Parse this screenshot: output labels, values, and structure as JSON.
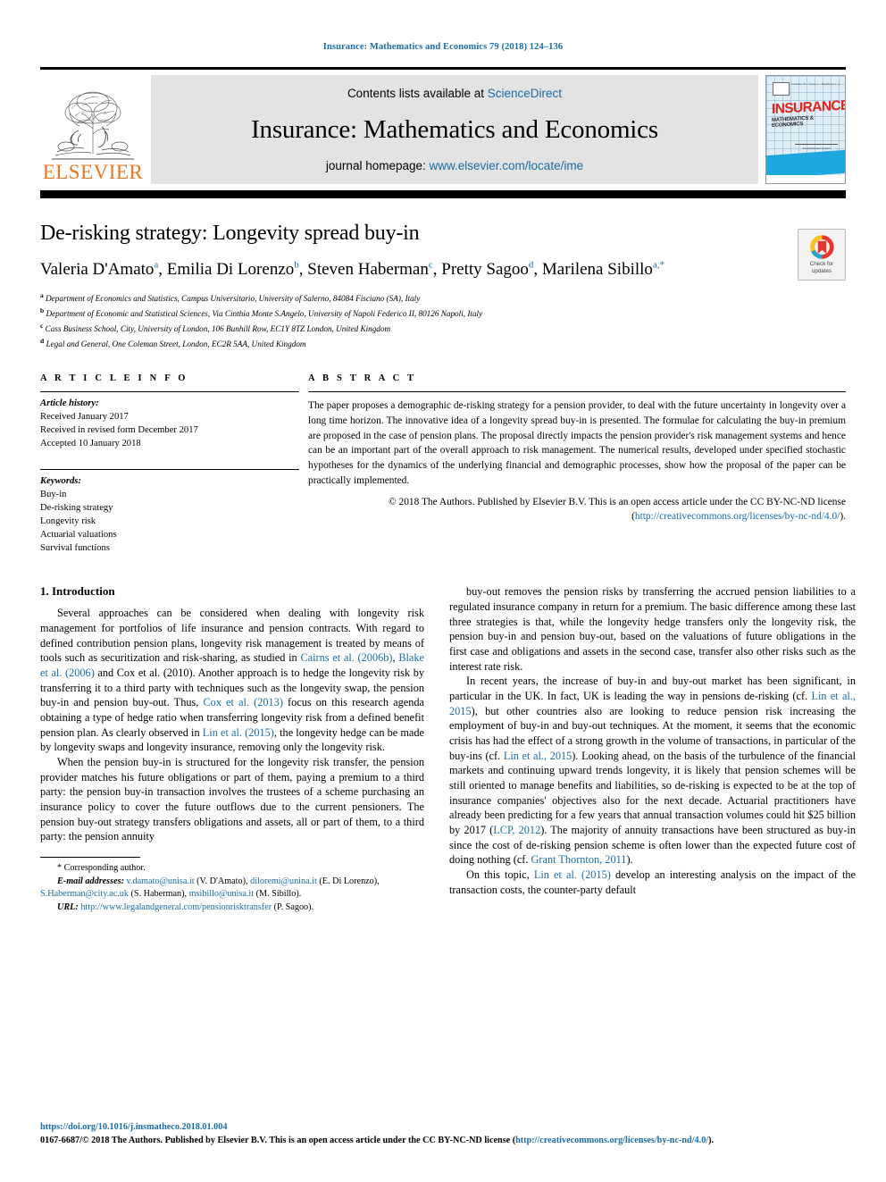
{
  "running_head": "Insurance: Mathematics and Economics 79 (2018) 124–136",
  "masthead": {
    "contents_prefix": "Contents lists available at ",
    "sciencedirect": "ScienceDirect",
    "journal_name": "Insurance: Mathematics and Economics",
    "homepage_prefix": "journal homepage: ",
    "homepage_url": "www.elsevier.com/locate/ime",
    "publisher_wordmark": "ELSEVIER",
    "publisher_color": "#E87722",
    "link_color": "#1b6ca8",
    "cover": {
      "title": "INSURANCE",
      "subtitle": "MATHEMATICS & ECONOMICS",
      "top_line": "Volume 79 / Issue 1 / Numbers 1–2              Nov 2018",
      "corner_note": "An International Journal",
      "band_color": "#1fa8e0",
      "title_color": "#e2231a"
    }
  },
  "article": {
    "title": "De-risking strategy: Longevity spread buy-in",
    "authors": [
      {
        "name": "Valeria D'Amato",
        "marks": "a",
        "sep": ", "
      },
      {
        "name": "Emilia Di Lorenzo",
        "marks": "b",
        "sep": ", "
      },
      {
        "name": "Steven Haberman",
        "marks": "c",
        "sep": ", "
      },
      {
        "name": "Pretty Sagoo",
        "marks": "d",
        "sep": ", "
      },
      {
        "name": "Marilena Sibillo",
        "marks": "a,*",
        "sep": ""
      }
    ],
    "affiliations": [
      {
        "mark": "a",
        "text": "Department of Economics and Statistics, Campus Universitario, University of Salerno, 84084 Fisciano (SA), Italy"
      },
      {
        "mark": "b",
        "text": "Department of Economic and Statistical Sciences, Via Cinthia Monte S.Angelo, University of Napoli Federico II, 80126 Napoli, Italy"
      },
      {
        "mark": "c",
        "text": "Cass Business School, City, University of London, 106 Bunhill Row, EC1Y 8TZ London, United Kingdom"
      },
      {
        "mark": "d",
        "text": "Legal and General, One Coleman Street, London, EC2R 5AA, United Kingdom"
      }
    ],
    "crossmark_label": "Check for\nupdates"
  },
  "article_info": {
    "heading": "A R T I C L E   I N F O",
    "history_label": "Article history:",
    "history": [
      "Received January 2017",
      "Received in revised form December 2017",
      "Accepted 10 January 2018"
    ],
    "keywords_label": "Keywords:",
    "keywords": [
      "Buy-in",
      "De-risking strategy",
      "Longevity risk",
      "Actuarial valuations",
      "Survival functions"
    ]
  },
  "abstract": {
    "heading": "A B S T R A C T",
    "text": "The paper proposes a demographic de-risking strategy for a pension provider, to deal with the future uncertainty in longevity over a long time horizon. The innovative idea of a longevity spread buy-in is presented. The formulae for calculating the buy-in premium are proposed in the case of pension plans. The proposal directly impacts the pension provider's risk management systems and hence can be an important part of the overall approach to risk management. The numerical results, developed under specified stochastic hypotheses for the dynamics of the underlying financial and demographic processes, show how the proposal of the paper can be practically implemented.",
    "copyright_text": "© 2018 The Authors. Published by Elsevier B.V. This is an open access article under the CC BY-NC-ND license (",
    "license_url": "http://creativecommons.org/licenses/by-nc-nd/4.0/",
    "copyright_tail": ")."
  },
  "body": {
    "section_title": "1. Introduction",
    "left_paragraphs": [
      "Several approaches can be considered when dealing with longevity risk management for portfolios of life insurance and pension contracts. With regard to defined contribution pension plans, longevity risk management is treated by means of tools such as securitization and risk-sharing, as studied in <ref>Cairns et al. (2006b)</ref>, <ref>Blake et al. (2006)</ref> and Cox et al. (2010). Another approach is to hedge the longevity risk by transferring it to a third party with techniques such as the longevity swap, the pension buy-in and pension buy-out. Thus, <ref>Cox et al. (2013)</ref> focus on this research agenda obtaining a type of hedge ratio when transferring longevity risk from a defined benefit pension plan. As clearly observed in <ref>Lin et al. (2015)</ref>, the longevity hedge can be made by longevity swaps and longevity insurance, removing only the longevity risk.",
      "When the pension buy-in is structured for the longevity risk transfer, the pension provider matches his future obligations or part of them, paying a premium to a third party: the pension buy-in transaction involves the trustees of a scheme purchasing an insurance policy to cover the future outflows due to the current pensioners. The pension buy-out strategy transfers obligations and assets, all or part of them, to a third party: the pension annuity"
    ],
    "right_paragraphs": [
      "buy-out removes the pension risks by transferring the accrued pension liabilities to a regulated insurance company in return for a premium. The basic difference among these last three strategies is that, while the longevity hedge transfers only the longevity risk, the pension buy-in and pension buy-out, based on the valuations of future obligations in the first case and obligations and assets in the second case, transfer also other risks such as the interest rate risk.",
      "In recent years, the increase of buy-in and buy-out market has been significant, in particular in the UK. In fact, UK is leading the way in pensions de-risking (cf. <ref>Lin et al., 2015</ref>), but other countries also are looking to reduce pension risk increasing the employment of buy-in and buy-out techniques. At the moment, it seems that the economic crisis has had the effect of a strong growth in the volume of transactions, in particular of the buy-ins (cf. <ref>Lin et al., 2015</ref>). Looking ahead, on the basis of the turbulence of the financial markets and continuing upward trends longevity, it is likely that pension schemes will be still oriented to manage benefits and liabilities, so de-risking is expected to be at the top of insurance companies' objectives also for the next decade. Actuarial practitioners have already been predicting for a few years that annual transaction volumes could hit $25 billion by 2017 (<ref>LCP, 2012</ref>). The majority of annuity transactions have been structured as buy-in since the cost of de-risking pension scheme is often lower than the expected future cost of doing nothing (cf. <ref>Grant Thornton, 2011</ref>).",
      "On this topic, <ref>Lin et al. (2015)</ref> develop an interesting analysis on the impact of the transaction costs, the counter-party default"
    ]
  },
  "footnotes": {
    "corresponding": "* Corresponding author.",
    "email_label": "E-mail addresses:",
    "emails": [
      {
        "address": "v.damato@unisa.it",
        "person": "(V. D'Amato)"
      },
      {
        "address": "diloremi@unina.it",
        "person": "(E. Di Lorenzo)"
      },
      {
        "address": "S.Haberman@city.ac.uk",
        "person": "(S. Haberman)"
      },
      {
        "address": "msibillo@unisa.it",
        "person": "(M. Sibillo)"
      }
    ],
    "url_label": "URL:",
    "url": "http://www.legalandgeneral.com/pensionrisktransfer",
    "url_person": "(P. Sagoo)"
  },
  "page_footer": {
    "doi": "https://doi.org/10.1016/j.insmatheco.2018.01.004",
    "issn_prefix": "0167-6687/",
    "issn_text": "© 2018 The Authors. Published by Elsevier B.V. This is an open access article under the CC BY-NC-ND license (",
    "issn_link": "http://creativecommons.org/licenses/by-nc-nd/4.0/",
    "issn_tail": ")."
  }
}
